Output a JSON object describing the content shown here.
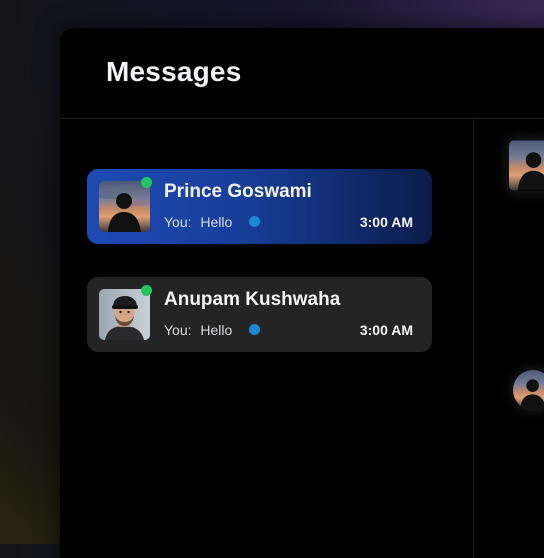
{
  "header": {
    "title": "Messages"
  },
  "conversations": [
    {
      "name": "Prince Goswami",
      "sender_prefix": "You:",
      "last_message": "Hello",
      "time": "3:00 AM",
      "online": true,
      "unread": true,
      "active": true,
      "avatar_icon": "silhouette-sunset-avatar"
    },
    {
      "name": "Anupam Kushwaha",
      "sender_prefix": "You:",
      "last_message": "Hello",
      "time": "3:00 AM",
      "online": true,
      "unread": true,
      "active": false,
      "avatar_icon": "man-with-cap-avatar"
    }
  ],
  "colors": {
    "active_card": "#1d4bb5",
    "inactive_card": "#242424",
    "online_dot": "#22c55e",
    "unread_dot": "#1a8ad6",
    "window_bg": "#000000"
  }
}
